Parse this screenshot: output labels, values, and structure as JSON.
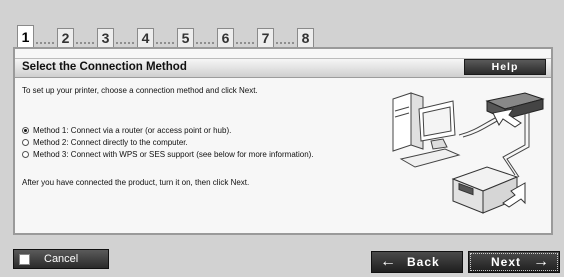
{
  "steps": [
    {
      "label": "1",
      "active": true
    },
    {
      "label": "2"
    },
    {
      "label": "3"
    },
    {
      "label": "4"
    },
    {
      "label": "5"
    },
    {
      "label": "6"
    },
    {
      "label": "7"
    },
    {
      "label": "8"
    }
  ],
  "panel": {
    "title": "Select the Connection Method",
    "help_label": "Help",
    "intro": "To set up your printer, choose a connection method and click Next.",
    "options": [
      {
        "label": "Method 1: Connect via a router (or access point or hub).",
        "checked": true
      },
      {
        "label": "Method 2: Connect directly to the computer.",
        "checked": false
      },
      {
        "label": "Method 3: Connect with WPS or SES support (see below for more information).",
        "checked": false
      }
    ],
    "after_text": "After you have connected the product, turn it on, then click Next."
  },
  "footer": {
    "cancel_label": "Cancel",
    "back_label": "Back",
    "next_label": "Next"
  },
  "icons": {
    "illustration": "computer-router-printer-illustration",
    "back": "left-arrow-icon",
    "next": "right-arrow-icon"
  }
}
